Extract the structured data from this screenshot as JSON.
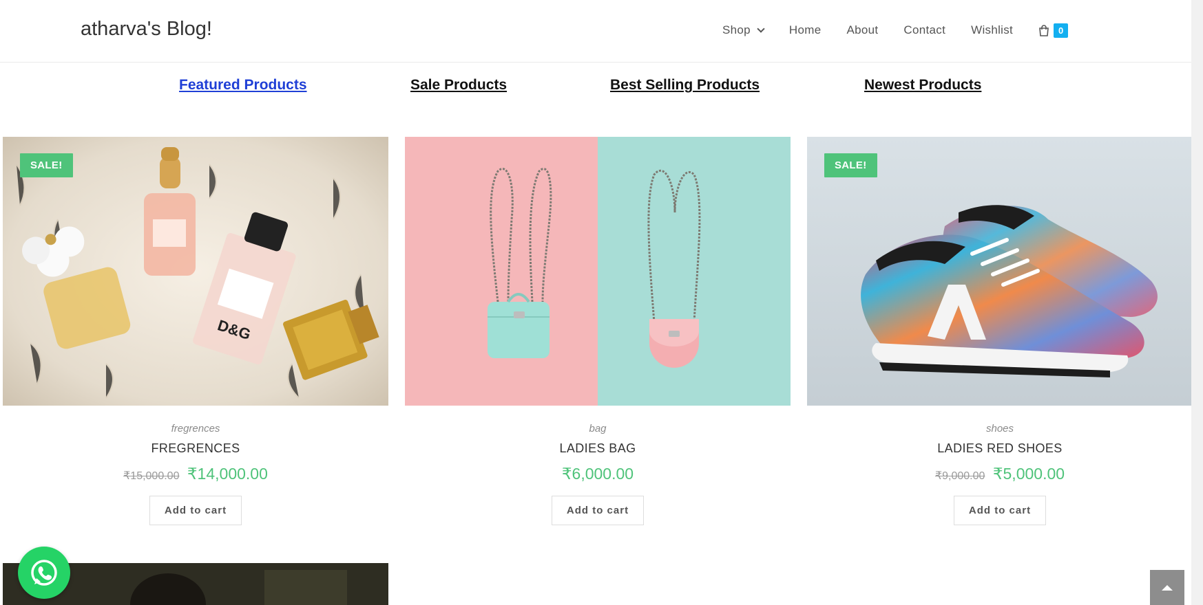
{
  "site": {
    "title": "atharva's Blog!"
  },
  "nav": {
    "items": [
      {
        "label": "Shop",
        "has_dropdown": true
      },
      {
        "label": "Home"
      },
      {
        "label": "About"
      },
      {
        "label": "Contact"
      },
      {
        "label": "Wishlist"
      }
    ],
    "cart_icon": "shopping-bag-icon",
    "cart_count": "0"
  },
  "tabs": [
    {
      "label": "Featured Products",
      "active": true
    },
    {
      "label": "Sale Products"
    },
    {
      "label": "Best Selling Products"
    },
    {
      "label": "Newest Products"
    }
  ],
  "products": [
    {
      "image": "perfume-bottles-on-fur-image",
      "sale_badge": "SALE!",
      "category": "fregrences",
      "name": "FREGRENCES",
      "old_price": "₹15,000.00",
      "price": "₹14,000.00",
      "button": "Add to cart"
    },
    {
      "image": "two-small-bags-on-pastel-background-image",
      "sale_badge": "",
      "category": "bag",
      "name": "LADIES BAG",
      "old_price": "",
      "price": "₹6,000.00",
      "button": "Add to cart"
    },
    {
      "image": "colorful-sneakers-image",
      "sale_badge": "SALE!",
      "category": "shoes",
      "name": "LADIES RED SHOES",
      "old_price": "₹9,000.00",
      "price": "₹5,000.00",
      "button": "Add to cart"
    }
  ],
  "colors": {
    "accent": "#13aff0",
    "sale": "#4fc37a",
    "active_tab": "#1f3fd6",
    "whatsapp": "#25d366"
  },
  "widgets": {
    "whatsapp_icon": "whatsapp-icon",
    "scroll_top_icon": "arrow-up-icon"
  }
}
